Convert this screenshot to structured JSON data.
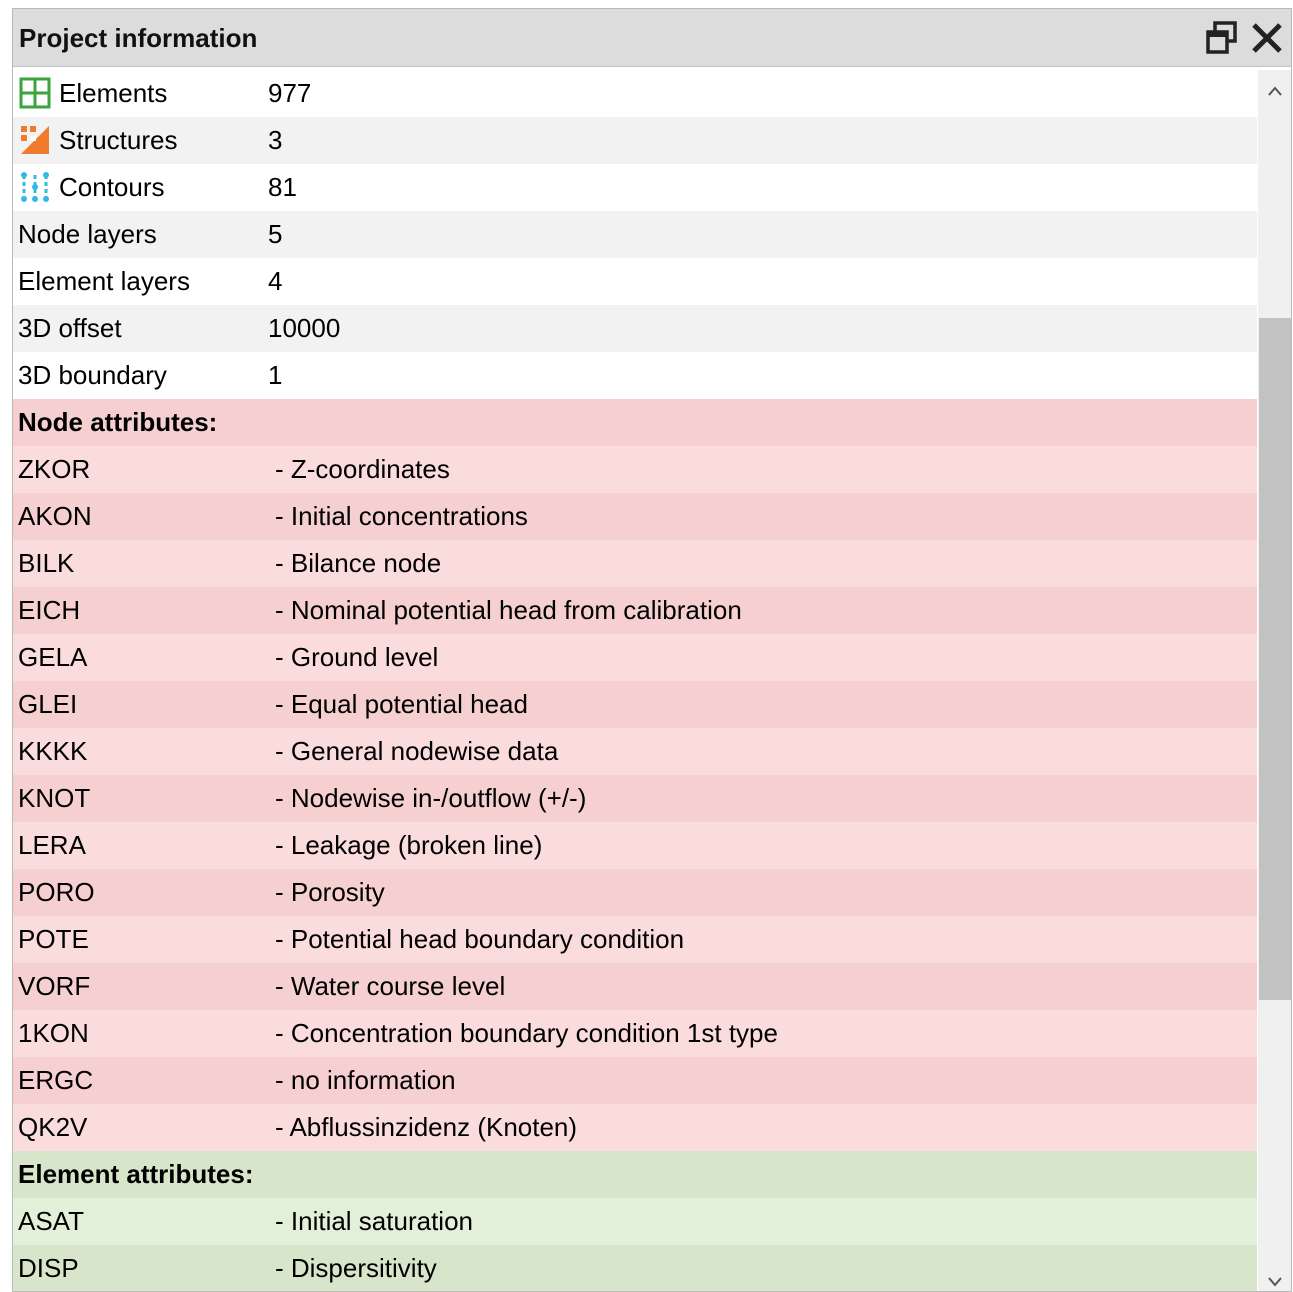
{
  "window": {
    "title": "Project information"
  },
  "summary": [
    {
      "label": "Elements",
      "value": "977",
      "icon": "elements-grid-icon"
    },
    {
      "label": "Structures",
      "value": "3",
      "icon": "structures-icon"
    },
    {
      "label": "Contours",
      "value": "81",
      "icon": "contours-icon"
    },
    {
      "label": "Node layers",
      "value": "5"
    },
    {
      "label": "Element layers",
      "value": "4"
    },
    {
      "label": "3D offset",
      "value": "10000"
    },
    {
      "label": "3D boundary",
      "value": "1"
    }
  ],
  "node_attributes": {
    "heading": "Node attributes:",
    "items": [
      {
        "code": "ZKOR",
        "desc": "- Z-coordinates"
      },
      {
        "code": "AKON",
        "desc": "- Initial concentrations"
      },
      {
        "code": "BILK",
        "desc": "- Bilance node"
      },
      {
        "code": "EICH",
        "desc": "- Nominal potential head from calibration"
      },
      {
        "code": "GELA",
        "desc": "- Ground level"
      },
      {
        "code": "GLEI",
        "desc": "- Equal potential head"
      },
      {
        "code": "KKKK",
        "desc": "- General nodewise data"
      },
      {
        "code": "KNOT",
        "desc": "- Nodewise in-/outflow (+/-)"
      },
      {
        "code": "LERA",
        "desc": "- Leakage (broken line)"
      },
      {
        "code": "PORO",
        "desc": "- Porosity"
      },
      {
        "code": "POTE",
        "desc": "- Potential head boundary condition"
      },
      {
        "code": "VORF",
        "desc": "- Water course level"
      },
      {
        "code": "1KON",
        "desc": "- Concentration boundary condition 1st type"
      },
      {
        "code": "ERGC",
        "desc": "- no information"
      },
      {
        "code": "QK2V",
        "desc": "- Abflussinzidenz (Knoten)"
      }
    ]
  },
  "element_attributes": {
    "heading": "Element attributes:",
    "items": [
      {
        "code": "ASAT",
        "desc": "- Initial saturation"
      },
      {
        "code": "DISP",
        "desc": "- Dispersitivity"
      }
    ]
  },
  "colors": {
    "titlebar": "#dcdcdc",
    "node_row_light": "#fbdcdc",
    "node_row_dark": "#f6d0d0",
    "element_row_light": "#e2efd9",
    "element_row_dark": "#d7e6cb",
    "elements_icon": "#3aa53a",
    "structures_icon": "#f07b2c",
    "contours_icon": "#35b8e8"
  },
  "scroll": {
    "position_fraction": 0.2,
    "visible_fraction": 0.56
  }
}
